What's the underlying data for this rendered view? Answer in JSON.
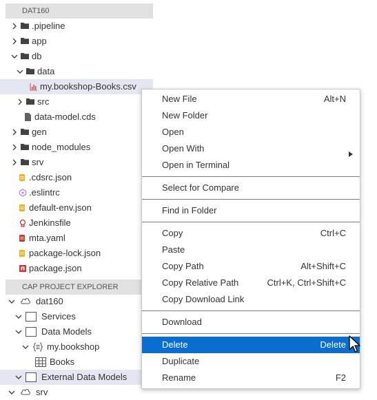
{
  "explorer": {
    "workspace_title": "DAT160",
    "tree": [
      {
        "label": ".pipeline",
        "icon": "folder-icon",
        "twisty": "chevron-right-icon"
      },
      {
        "label": "app",
        "icon": "folder-icon",
        "twisty": "chevron-right-icon"
      },
      {
        "label": "db",
        "icon": "folder-icon",
        "twisty": "chevron-down-icon"
      },
      {
        "label": "data",
        "icon": "folder-icon",
        "twisty": "chevron-down-icon"
      },
      {
        "label": "my.bookshop-Books.csv",
        "icon": "csv-file-icon",
        "twisty": ""
      },
      {
        "label": "src",
        "icon": "folder-icon",
        "twisty": "chevron-right-icon"
      },
      {
        "label": "data-model.cds",
        "icon": "file-icon",
        "twisty": ""
      },
      {
        "label": "gen",
        "icon": "folder-icon",
        "twisty": "chevron-right-icon"
      },
      {
        "label": "node_modules",
        "icon": "folder-icon",
        "twisty": "chevron-right-icon"
      },
      {
        "label": "srv",
        "icon": "folder-icon",
        "twisty": "chevron-right-icon"
      },
      {
        "label": ".cdsrc.json",
        "icon": "json-file-icon",
        "twisty": ""
      },
      {
        "label": ".eslintrc",
        "icon": "eslint-file-icon",
        "twisty": ""
      },
      {
        "label": "default-env.json",
        "icon": "json-file-icon",
        "twisty": ""
      },
      {
        "label": "Jenkinsfile",
        "icon": "jenkins-file-icon",
        "twisty": ""
      },
      {
        "label": "mta.yaml",
        "icon": "yaml-file-icon",
        "twisty": ""
      },
      {
        "label": "package-lock.json",
        "icon": "json-file-icon",
        "twisty": ""
      },
      {
        "label": "package.json",
        "icon": "npm-file-icon",
        "twisty": ""
      }
    ]
  },
  "cap": {
    "section_title": "CAP PROJECT EXPLORER",
    "tree": [
      {
        "label": "dat160",
        "icon": "cloud-icon",
        "twisty": "chevron-down-icon"
      },
      {
        "label": "Services",
        "icon": "box-icon",
        "twisty": "chevron-down-icon"
      },
      {
        "label": "Data Models",
        "icon": "box-icon",
        "twisty": "chevron-down-icon"
      },
      {
        "label": "my.bookshop",
        "icon": "namespace-icon",
        "twisty": "chevron-down-icon"
      },
      {
        "label": "Books",
        "icon": "table-icon",
        "twisty": ""
      },
      {
        "label": "External Data Models",
        "icon": "box-icon",
        "twisty": "chevron-down-icon"
      },
      {
        "label": "srv",
        "icon": "cloud-icon",
        "twisty": "chevron-down-icon"
      }
    ]
  },
  "context_menu": {
    "groups": [
      [
        {
          "label": "New File",
          "shortcut": "Alt+N"
        },
        {
          "label": "New Folder",
          "shortcut": ""
        },
        {
          "label": "Open",
          "shortcut": ""
        },
        {
          "label": "Open With",
          "shortcut": "",
          "submenu": true
        },
        {
          "label": "Open in Terminal",
          "shortcut": ""
        }
      ],
      [
        {
          "label": "Select for Compare",
          "shortcut": ""
        }
      ],
      [
        {
          "label": "Find in Folder",
          "shortcut": ""
        }
      ],
      [
        {
          "label": "Copy",
          "shortcut": "Ctrl+C"
        },
        {
          "label": "Paste",
          "shortcut": ""
        },
        {
          "label": "Copy Path",
          "shortcut": "Alt+Shift+C"
        },
        {
          "label": "Copy Relative Path",
          "shortcut": "Ctrl+K, Ctrl+Shift+C"
        },
        {
          "label": "Copy Download Link",
          "shortcut": ""
        }
      ],
      [
        {
          "label": "Download",
          "shortcut": ""
        }
      ],
      [
        {
          "label": "Delete",
          "shortcut": "Delete",
          "active": true
        },
        {
          "label": "Duplicate",
          "shortcut": ""
        },
        {
          "label": "Rename",
          "shortcut": "F2"
        }
      ]
    ]
  },
  "colors": {
    "highlight": "#0a6ed1",
    "selected_row": "#e4e6f1",
    "folder": "#424242",
    "json_icon": "#f0b429",
    "eslint_icon": "#b48ed8",
    "jenkins_icon": "#d33833",
    "yaml_icon": "#d33833",
    "npm_icon": "#cb3837",
    "csv_icon": "#d24a4a"
  }
}
